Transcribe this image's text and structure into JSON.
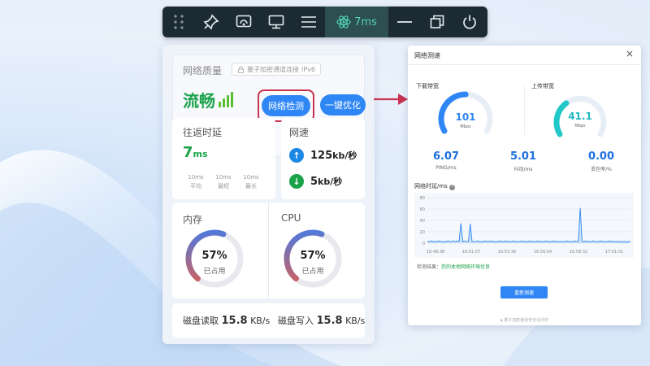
{
  "toolbar": {
    "items": [
      "grip-icon",
      "pin-icon",
      "cast-icon",
      "monitor-icon",
      "menu-icon",
      "atom-icon",
      "minimize-icon",
      "restore-icon",
      "power-icon"
    ],
    "ping_label": "7ms"
  },
  "quality": {
    "title": "网络质量",
    "badge": "量子加密通道连接",
    "badge_version": "IPv6",
    "status": "流畅",
    "detect_button": "网络检测",
    "optimize_button": "一键优化"
  },
  "rtt": {
    "title": "往返时延",
    "value": "7",
    "unit": "ms",
    "stats": [
      {
        "value": "10ms",
        "label": "平均"
      },
      {
        "value": "10ms",
        "label": "最短"
      },
      {
        "value": "10ms",
        "label": "最长"
      }
    ]
  },
  "speed": {
    "title": "网速",
    "upload_value": "125",
    "upload_unit": "kb/秒",
    "download_value": "5",
    "download_unit": "kb/秒"
  },
  "memory": {
    "title": "内存",
    "percent_label": "57%",
    "percent": 57,
    "sub": "已占用"
  },
  "cpu": {
    "title": "CPU",
    "percent_label": "57%",
    "percent": 57,
    "sub": "已占用"
  },
  "disk": {
    "read_label": "磁盘读取",
    "read_value": "15.8",
    "read_unit": "KB/s",
    "write_label": "磁盘写入",
    "write_value": "15.8",
    "write_unit": "KB/s"
  },
  "dialog": {
    "title": "网络测速",
    "close": "×",
    "download_title": "下载带宽",
    "download_value": "101",
    "download_unit": "Mbps",
    "download_fraction": 0.5,
    "upload_title": "上传带宽",
    "upload_value": "41.1",
    "upload_unit": "Mbps",
    "upload_fraction": 0.35,
    "stats": [
      {
        "value": "6.07",
        "label": "PING/ms"
      },
      {
        "value": "5.01",
        "label": "抖动/ms"
      },
      {
        "value": "0.00",
        "label": "丢包率/%"
      }
    ],
    "latency_title": "网络时延/ms",
    "result_label": "检测结果：",
    "result_text": "您的本地网络环境优良",
    "retest_button": "重新测速",
    "footer": "量子加密通道安全访问中"
  },
  "chart_data": {
    "type": "line",
    "title": "网络时延/ms",
    "ylim": [
      0,
      80
    ],
    "yticks": [
      0,
      20,
      40,
      60,
      80
    ],
    "xticks": [
      "16:48:38",
      "16:51:07",
      "16:53:36",
      "16:56:04",
      "16:58:32",
      "17:01:01"
    ],
    "grid": true,
    "series": [
      {
        "values": [
          3,
          3,
          4,
          3,
          3,
          3,
          4,
          3,
          3,
          2,
          3,
          4,
          3,
          3,
          4,
          3,
          4,
          3,
          35,
          3,
          4,
          3,
          3,
          34,
          3,
          3,
          3,
          4,
          3,
          3,
          3,
          4,
          3,
          3,
          4,
          3,
          3,
          3,
          3,
          4,
          3,
          3,
          4,
          3,
          3,
          3,
          4,
          3,
          3,
          3,
          3,
          4,
          3,
          3,
          3,
          4,
          3,
          3,
          3,
          4,
          3,
          3,
          3,
          3,
          4,
          3,
          3,
          3,
          4,
          3,
          3,
          3,
          3,
          3,
          3,
          4,
          3,
          3,
          3,
          4,
          3,
          3,
          62,
          3,
          3,
          4,
          3,
          3,
          3,
          4,
          3,
          3,
          3,
          4,
          3,
          3,
          3,
          3,
          4,
          3,
          3,
          3,
          3,
          3,
          2,
          3,
          3,
          2,
          3,
          3
        ]
      }
    ]
  },
  "colors": {
    "accent": "#2f86f5",
    "good": "#1aa34a",
    "highlight_border": "#c9334f",
    "arrow": "#c9334f",
    "toolbar_bg": "#1c2a34",
    "ping_bg": "#2e4f52",
    "ping_text": "#4fd3b3",
    "upload_icon": "#1e88e5",
    "download_icon": "#1aa34a",
    "gauge_track": "#e8e8ee"
  }
}
